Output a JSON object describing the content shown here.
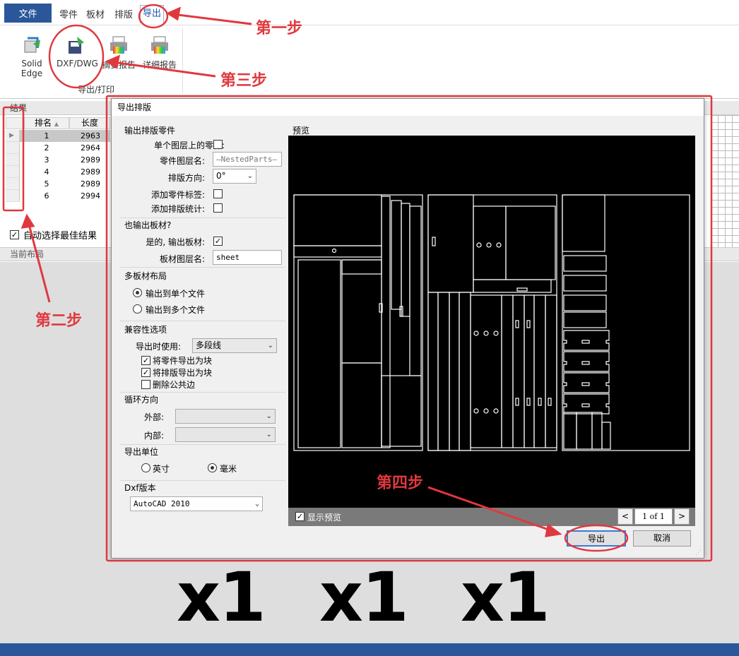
{
  "menubar": {
    "file": "文件",
    "tabs": [
      "零件",
      "板材",
      "排版",
      "导出"
    ]
  },
  "ribbon": {
    "btn_solidedge": "Solid Edge",
    "btn_dxf": "DXF/DWG",
    "btn_summary": "摘要报告",
    "btn_detail": "详细报告",
    "group_label": "导出/打印"
  },
  "results": {
    "header": "结果",
    "col_rank": "排名",
    "col_length": "长度",
    "rows": [
      {
        "rank": "1",
        "length": "2963"
      },
      {
        "rank": "2",
        "length": "2964"
      },
      {
        "rank": "3",
        "length": "2989"
      },
      {
        "rank": "4",
        "length": "2989"
      },
      {
        "rank": "5",
        "length": "2989"
      },
      {
        "rank": "6",
        "length": "2994"
      }
    ],
    "auto_select": "自动选择最佳结果"
  },
  "layout": {
    "header": "当前布局",
    "counts": [
      "x1",
      "x1",
      "x1"
    ]
  },
  "dialog": {
    "title": "导出排版",
    "sec_parts": "输出排版零件",
    "single_layer": "单个图层上的零件:",
    "part_layer": "零件图层名:",
    "part_layer_val": "—NestedParts—",
    "orientation": "排版方向:",
    "orientation_val": "0°",
    "add_label": "添加零件标签:",
    "add_stats": "添加排版统计:",
    "sec_sheet": "也输出板材?",
    "yes_sheet": "是的, 输出板材:",
    "sheet_layer": "板材图层名:",
    "sheet_layer_val": "sheet",
    "sec_multi": "多板材布局",
    "single_file": "输出到单个文件",
    "multi_file": "输出到多个文件",
    "sec_compat": "兼容性选项",
    "export_use": "导出时使用:",
    "export_use_val": "多段线",
    "part_block": "将零件导出为块",
    "layout_block": "将排版导出为块",
    "del_common": "删除公共边",
    "sec_loop": "循环方向",
    "outer": "外部:",
    "inner": "内部:",
    "sec_unit": "导出单位",
    "inch": "英寸",
    "mm": "毫米",
    "sec_dxf": "Dxf版本",
    "dxf_val": "AutoCAD 2010",
    "preview": "预览",
    "show_preview": "显示预览",
    "page": "1 of 1",
    "export_btn": "导出",
    "cancel_btn": "取消"
  },
  "annotations": {
    "step1": "第一步",
    "step2": "第二步",
    "step3": "第三步",
    "step4": "第四步"
  },
  "colors": {
    "accent": "#2b579a",
    "annotation": "#e0383e"
  }
}
